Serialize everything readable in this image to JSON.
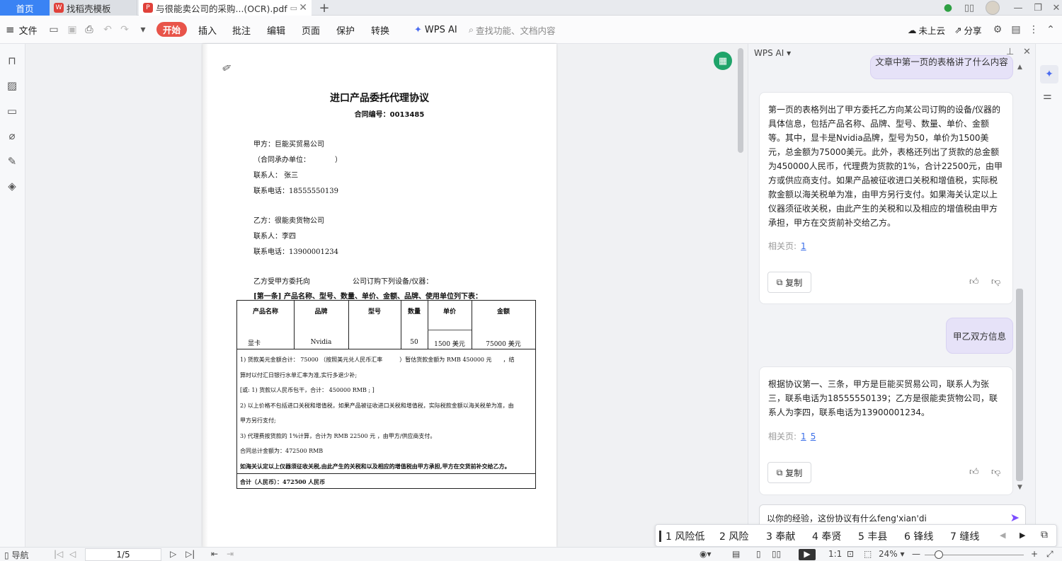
{
  "tabs": {
    "home": "首页",
    "template": "找稻壳模板",
    "pdf": "与很能卖公司的采购...(OCR).pdf"
  },
  "toolbar": {
    "file": "文件",
    "start": "开始",
    "insert": "插入",
    "annotate": "批注",
    "edit": "编辑",
    "page": "页面",
    "protect": "保护",
    "convert": "转换",
    "wps_ai": "WPS AI",
    "search_placeholder": "查找功能、文档内容",
    "cloud": "未上云",
    "share": "分享"
  },
  "document": {
    "title": "进口产品委托代理协议",
    "contract_no": "合同编号：0013485",
    "lines": [
      "甲方：巨能买贸易公司",
      "（合同承办单位：　　　　）",
      "联系人：  张三",
      "联系电话：18555550139",
      "乙方：很能卖货物公司",
      "联系人：李四",
      "联系电话：13900001234",
      "乙方受甲方委托向　　　　　　公司订购下列设备/仪器：",
      "[第一条] 产品名称、型号、数量、单价、金额、品牌、使用单位列下表："
    ],
    "table": {
      "headers": [
        "产品名称",
        "品牌",
        "型号",
        "数量",
        "单价",
        "金额"
      ],
      "row": [
        "显卡",
        "Nvidia",
        "",
        "50",
        "1500 美元",
        "75000 美元"
      ],
      "notes": [
        "1) 货款美元金额合计：  75000 （按照美元兑人民币汇率　　　）暂估货款金额为 RMB  450000 元　　，结",
        "算时以付汇日银行水单汇率为准,实行多退少补;",
        "[或:   1) 货款以人民币包干，合计：  450000 RMB ;  ]",
        "2) 以上价格不包括进口关税和增值税，如果产品被征收进口关税和增值税，实际税款金额以海关税单为准，由",
        "甲方另行支付;",
        "3) 代理费按货款的   1%计算，合计为 RMB   22500 元  ，由甲方/供应商支付。",
        "合同总计金额为：472500 RMB",
        "如海关认定以上仪器须征收关税,由此产生的关税和以及相应的增值税由甲方承担,甲方在交货前补交给乙方。",
        "合计（人民币）：472500 人民币"
      ]
    }
  },
  "ai_panel": {
    "title": "WPS AI",
    "prev_question": "文章中第一页的表格讲了什么内容",
    "answer1": "第一页的表格列出了甲方委托乙方向某公司订购的设备/仪器的具体信息，包括产品名称、品牌、型号、数量、单价、金额等。其中，显卡是Nvidia品牌，型号为50，单价为1500美元，总金额为75000美元。此外，表格还列出了货款的总金额为450000人民币，代理费为货款的1%，合计22500元，由甲方或供应商支付。如果产品被征收进口关税和增值税，实际税款金额以海关税单为准，由甲方另行支付。如果海关认定以上仪器须征收关税，由此产生的关税和以及相应的增值税由甲方承担，甲方在交货前补交给乙方。",
    "related_label": "相关页:",
    "answer1_pages": [
      "1"
    ],
    "copy_label": "复制",
    "question2": "甲乙双方信息",
    "answer2": "根据协议第一、三条，甲方是巨能买贸易公司，联系人为张三，联系电话为18555550139；乙方是很能卖货物公司，联系人为李四，联系电话为13900001234。",
    "answer2_pages": [
      "1",
      "5"
    ],
    "input_value": "以你的经验，这份协议有什么feng'xian'di"
  },
  "ime": {
    "candidates": [
      "1 风险低",
      "2 风险",
      "3 奉献",
      "4 奉贤",
      "5 丰县",
      "6 锋线",
      "7 缝线"
    ]
  },
  "statusbar": {
    "nav": "导航",
    "page": "1/5",
    "zoom": "24%"
  },
  "colors": {
    "accent_blue": "#3a83f4",
    "start_red": "#e8544a",
    "ai_purple": "#7c4dff",
    "sheet_green": "#1fa46a"
  }
}
